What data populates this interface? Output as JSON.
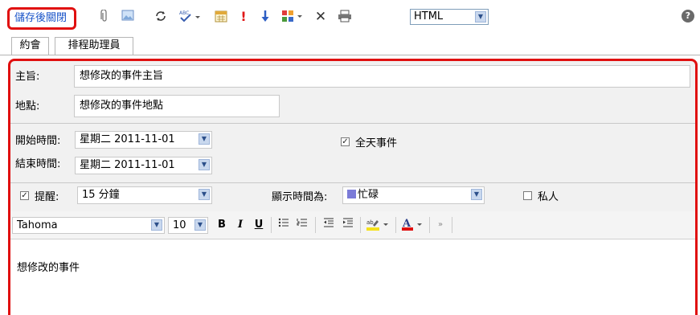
{
  "toolbar": {
    "save_close": "儲存後關閉",
    "format": "HTML",
    "icons": [
      "attach-icon",
      "insert-image-icon",
      "recurrence-icon",
      "spellcheck-icon",
      "calendar-icon",
      "high-importance-icon",
      "low-importance-icon",
      "categorize-icon",
      "delete-icon",
      "print-icon",
      "help-icon"
    ]
  },
  "tabs": [
    {
      "label": "約會"
    },
    {
      "label": "排程助理員"
    }
  ],
  "form": {
    "subject_label": "主旨:",
    "subject_value": "想修改的事件主旨",
    "location_label": "地點:",
    "location_value": "想修改的事件地點",
    "start_label": "開始時間:",
    "start_value": "星期二 2011-11-01",
    "end_label": "結束時間:",
    "end_value": "星期二 2011-11-01",
    "all_day_label": "全天事件",
    "all_day_checked": true,
    "reminder_label": "提醒:",
    "reminder_checked": true,
    "reminder_value": "15 分鐘",
    "show_as_label": "顯示時間為:",
    "show_as_value": "忙碌",
    "show_as_color": "#7b7bd8",
    "private_label": "私人",
    "private_checked": false
  },
  "editor": {
    "font": "Tahoma",
    "size": "10",
    "bold": "B",
    "italic": "I",
    "underline": "U",
    "body_text": "想修改的事件"
  },
  "colors": {
    "highlight_red": "#e01010",
    "link_blue": "#1a55c9"
  }
}
